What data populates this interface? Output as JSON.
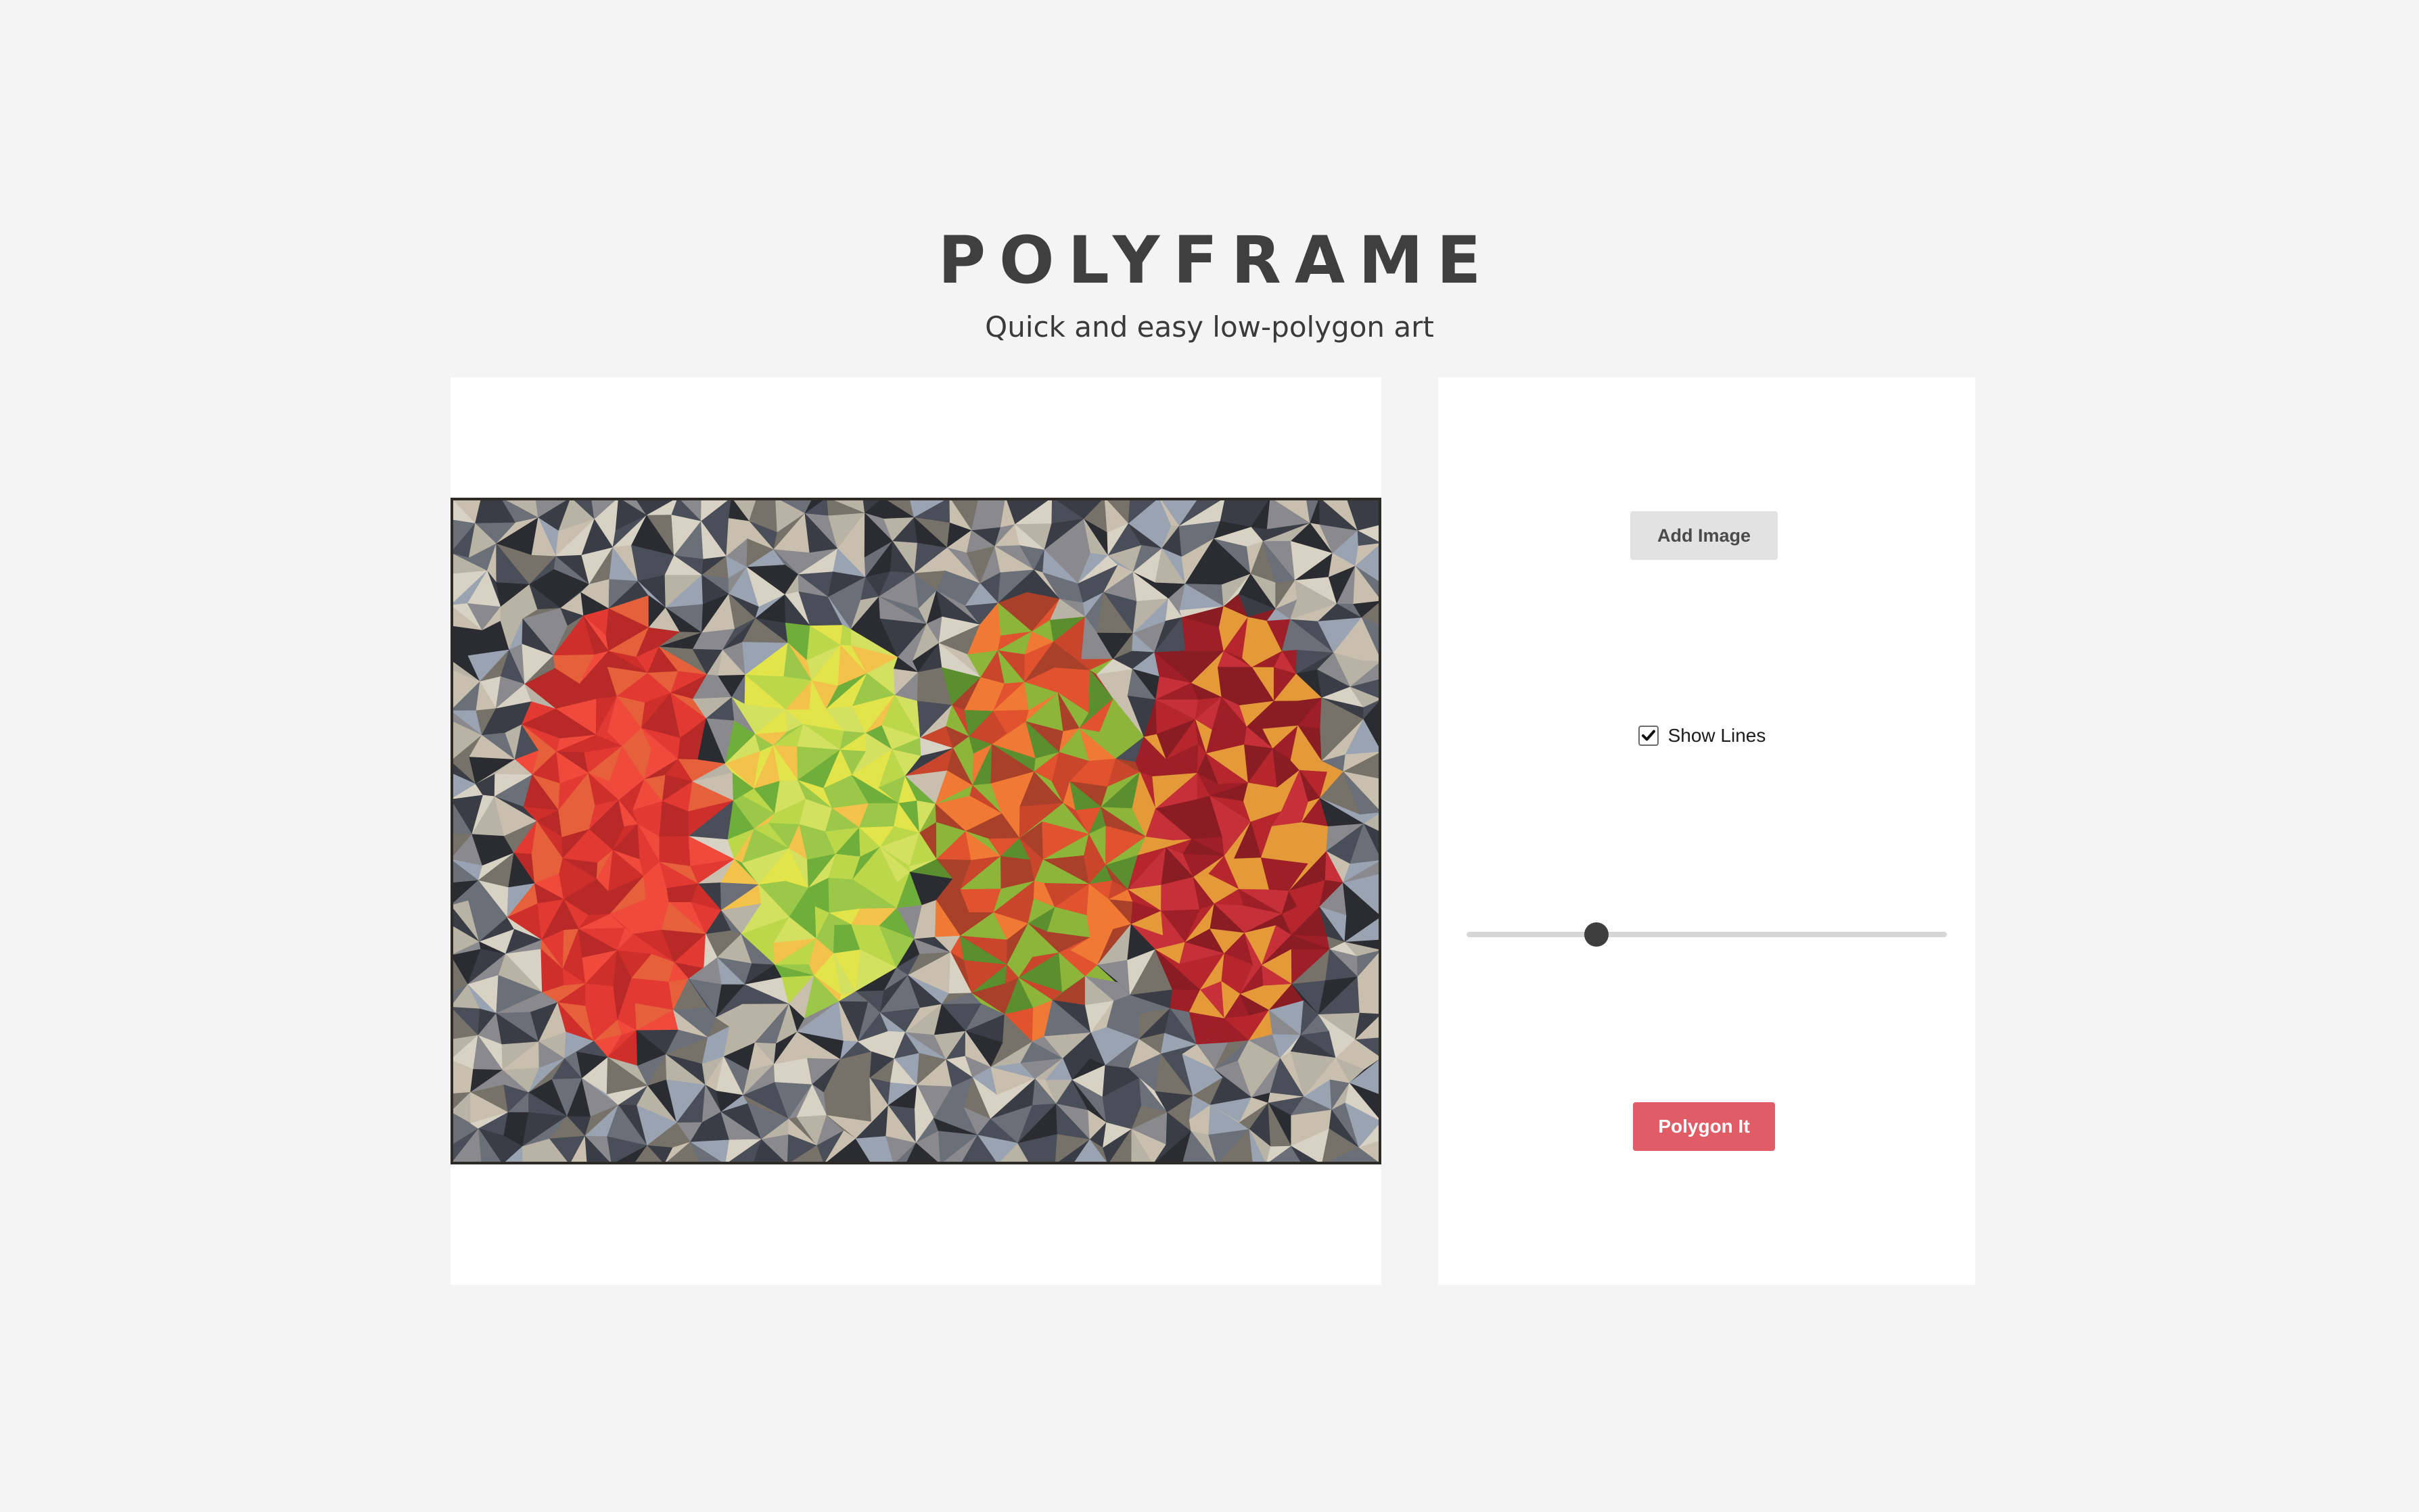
{
  "header": {
    "title": "POLYFRAME",
    "subtitle": "Quick and easy low-polygon art"
  },
  "canvas": {
    "description_icon": "low-poly-artwork",
    "palette": {
      "background": [
        "#8a8a8e",
        "#6b6f78",
        "#4a4e58",
        "#b9b3a6",
        "#d8d2c4",
        "#3a3d45",
        "#9aa3b2",
        "#2a2c31",
        "#c9bfae",
        "#777269"
      ],
      "leaf_red": [
        "#e23a33",
        "#cf2f2b",
        "#f04a3c",
        "#b82a28",
        "#e6603b"
      ],
      "leaf_yellow_green": [
        "#e3e34a",
        "#bcd84a",
        "#9cc84a",
        "#6fae3a",
        "#f2c24a",
        "#d4e060"
      ],
      "leaf_orange": [
        "#e0532e",
        "#c9452b",
        "#f07a35",
        "#a8402a",
        "#5b8e2e",
        "#8cb53a"
      ],
      "leaf_crimson": [
        "#b5262d",
        "#9e1f27",
        "#c63038",
        "#8a1c23",
        "#e59a3a"
      ]
    }
  },
  "controls": {
    "add_image_label": "Add Image",
    "show_lines_label": "Show Lines",
    "show_lines_checked": true,
    "slider_value": 0.27,
    "polygon_label": "Polygon It",
    "accent_color": "#e05d67",
    "secondary_button_color": "#e2e2e3"
  }
}
